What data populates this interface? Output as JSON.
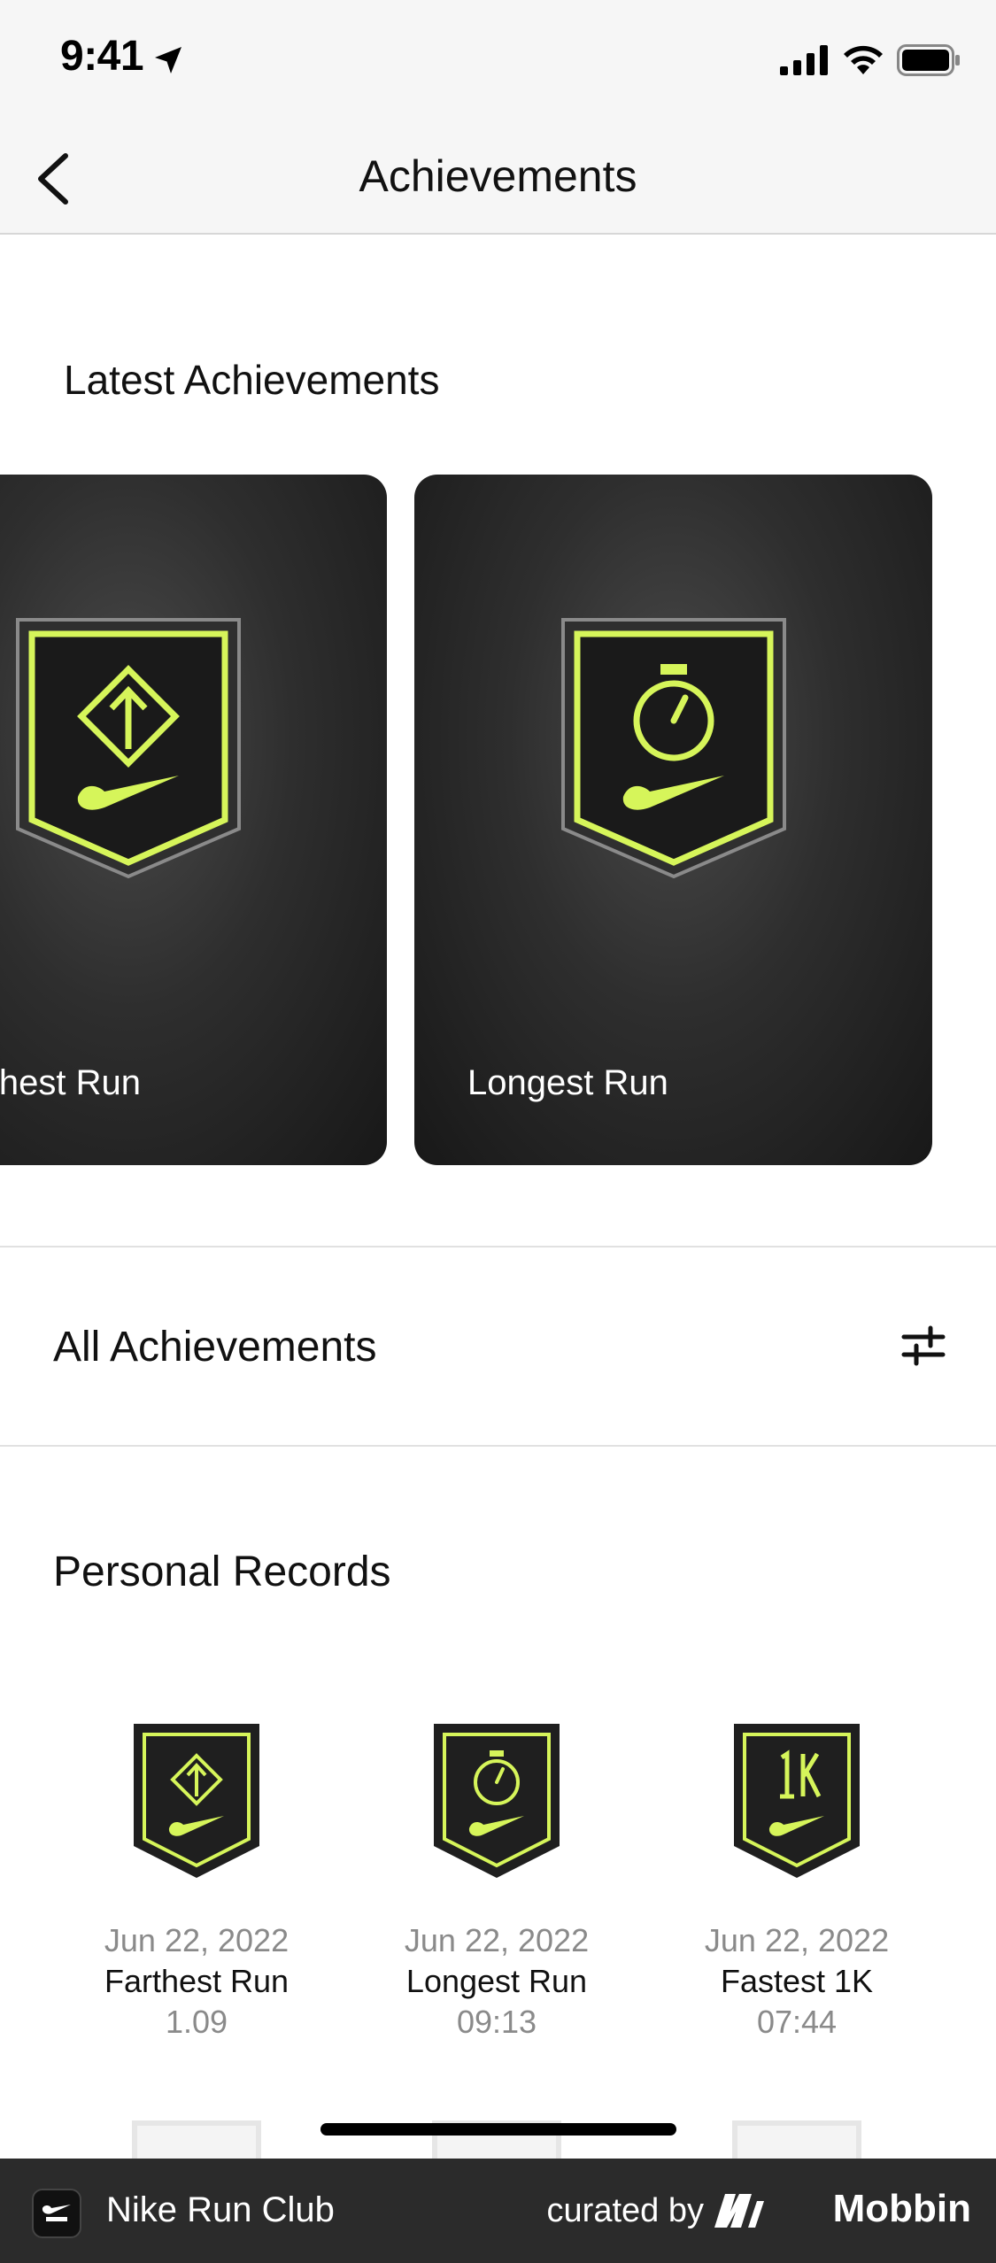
{
  "status_bar": {
    "time": "9:41"
  },
  "nav": {
    "title": "Achievements"
  },
  "latest": {
    "heading": "Latest Achievements",
    "cards": [
      {
        "label": "Farthest Run",
        "icon": "farthest-run-badge-icon"
      },
      {
        "label": "Longest Run",
        "icon": "longest-run-badge-icon"
      }
    ]
  },
  "all_achievements": {
    "label": "All Achievements"
  },
  "personal_records": {
    "heading": "Personal Records",
    "items": [
      {
        "date": "Jun 22, 2022",
        "title": "Farthest Run",
        "value": "1.09",
        "icon": "farthest-run-badge-icon"
      },
      {
        "date": "Jun 22, 2022",
        "title": "Longest Run",
        "value": "09:13",
        "icon": "longest-run-badge-icon"
      },
      {
        "date": "Jun 22, 2022",
        "title": "Fastest 1K",
        "value": "07:44",
        "icon": "fastest-1k-badge-icon"
      }
    ]
  },
  "footer": {
    "app_name": "Nike Run Club",
    "curated_by": "curated by",
    "brand": "Mobbin"
  },
  "colors": {
    "accent": "#d6f55a",
    "card_dark": "#222222",
    "footer_bg": "#2b2b2b"
  }
}
